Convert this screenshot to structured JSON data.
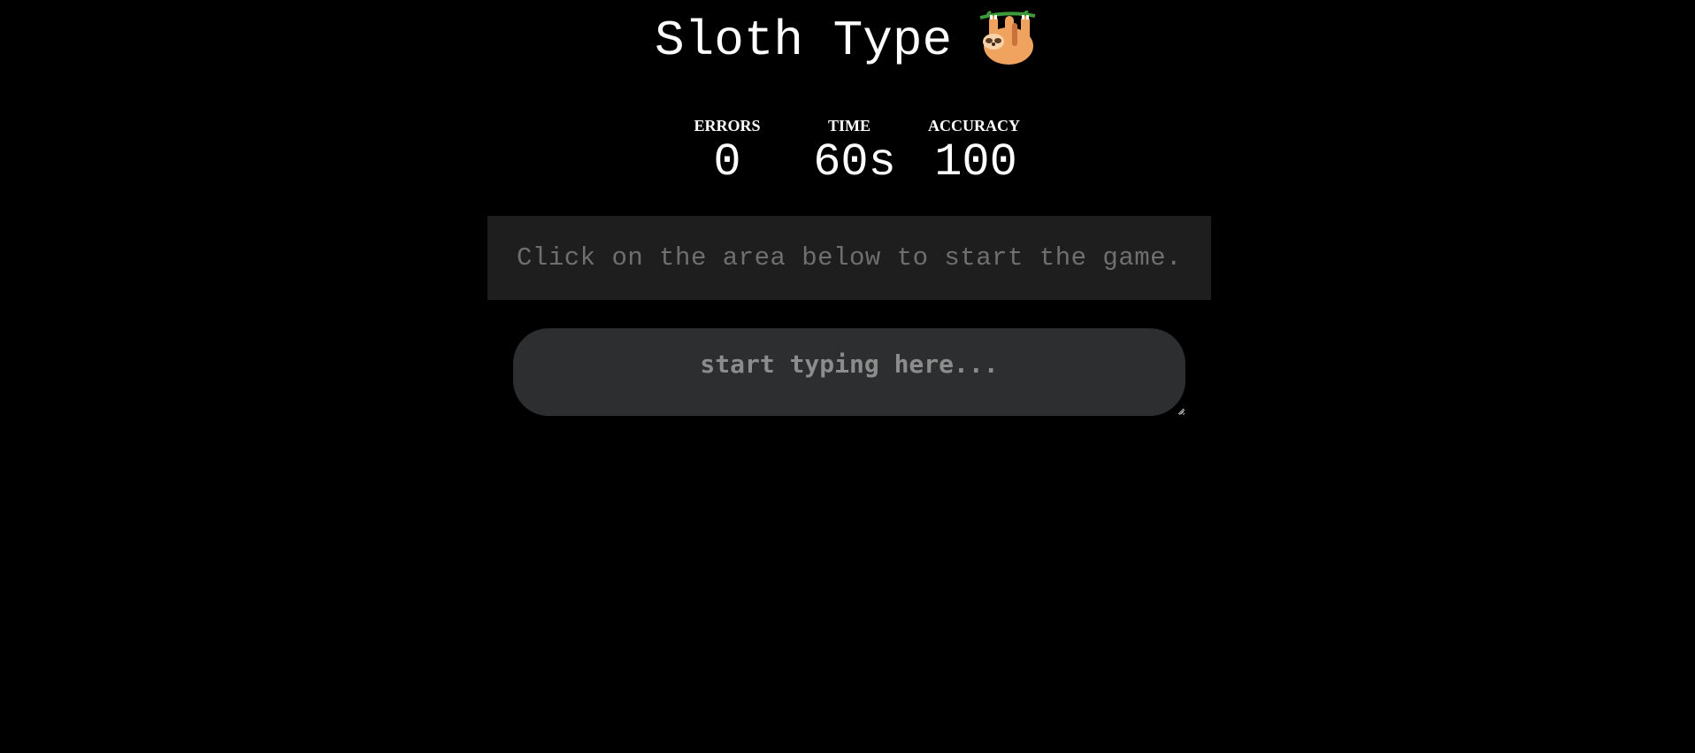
{
  "app": {
    "title": "Sloth Type",
    "logo_icon": "sloth-icon"
  },
  "stats": {
    "errors_label": "ERRORS",
    "errors_value": "0",
    "time_label": "TIME",
    "time_value": "60s",
    "accuracy_label": "ACCURACY",
    "accuracy_value": "100"
  },
  "quote": {
    "text": "Click on the area below to start the game."
  },
  "input": {
    "value": "",
    "placeholder": "start typing here..."
  },
  "colors": {
    "background": "#000000",
    "quote_background": "#1e1e1e",
    "quote_text": "#6f6f6f",
    "input_background": "#2d2e30",
    "placeholder": "#8c8c8c"
  }
}
